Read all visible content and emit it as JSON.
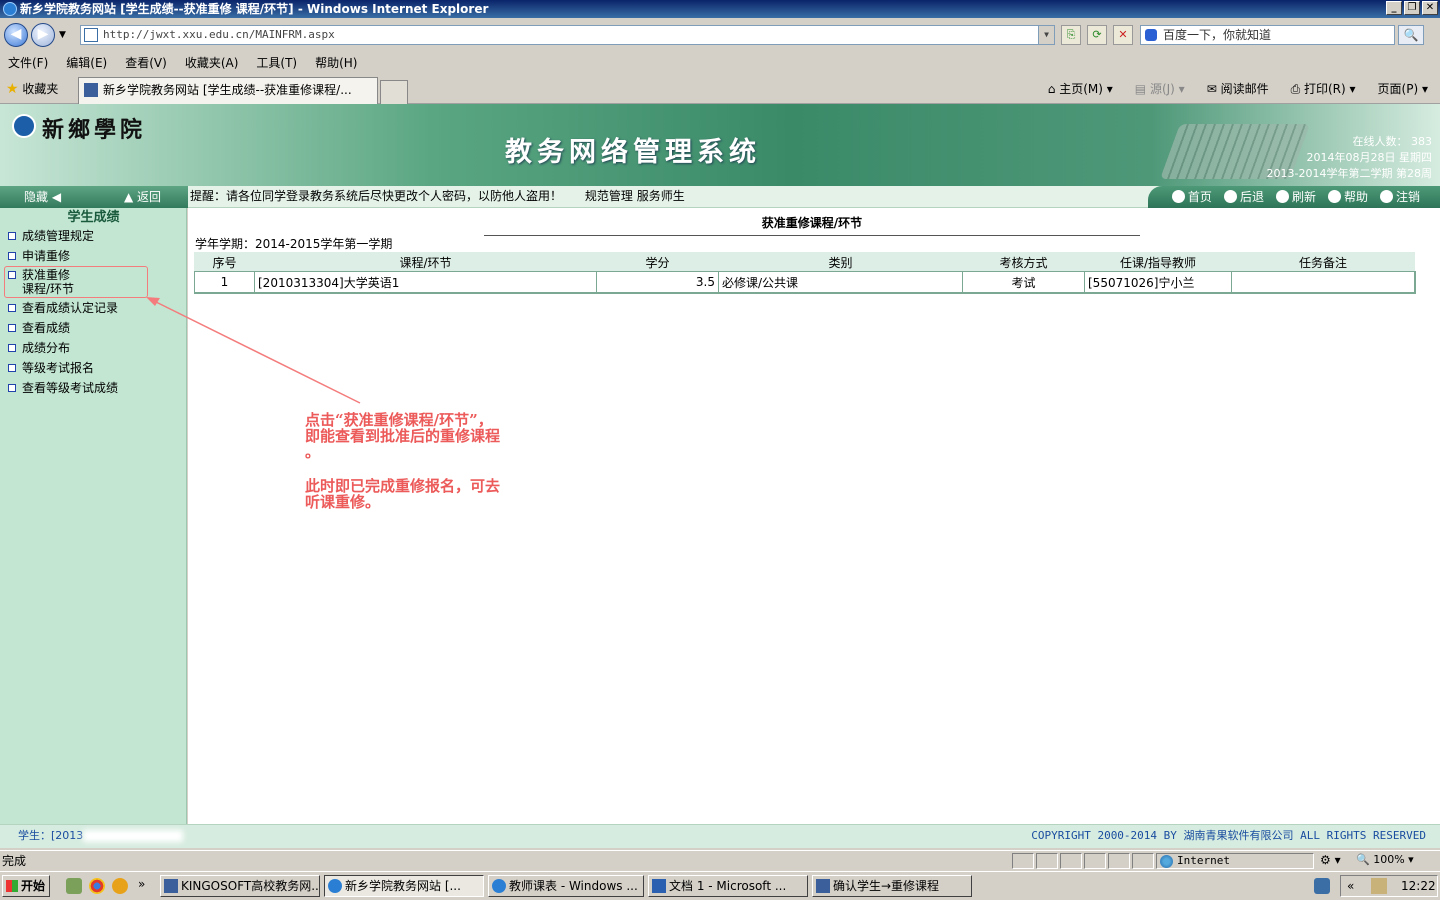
{
  "window": {
    "title": "新乡学院教务网站 [学生成绩--获准重修  课程/环节] - Windows Internet Explorer",
    "minimize": "_",
    "restore": "❐",
    "close": "✕"
  },
  "browser": {
    "address": "http://jwxt.xxu.edu.cn/MAINFRM.aspx",
    "search_text": "百度一下，你就知道",
    "menu": [
      "文件(F)",
      "编辑(E)",
      "查看(V)",
      "收藏夹(A)",
      "工具(T)",
      "帮助(H)"
    ],
    "favorites_label": "收藏夹",
    "tab_title": "新乡学院教务网站 [学生成绩--获准重修课程/...",
    "commands": {
      "home": "主页(M)",
      "feeds": "源(J)",
      "read_mail": "阅读邮件",
      "print": "打印(R)",
      "page": "页面(P)"
    }
  },
  "header": {
    "school_name": "新鄉學院",
    "system_title": "教务网络管理系统",
    "online_label": "在线人数：",
    "online_count": "383",
    "date": "2014年08月28日 星期四",
    "term_week": "2013-2014学年第二学期 第28周"
  },
  "navstrip": {
    "hide": "隐藏",
    "back": "返回",
    "notice": "提醒：请各位同学登录教务系统后尽快更改个人密码，以防他人盗用！",
    "slogan": "规范管理 服务师生",
    "links": [
      "首页",
      "后退",
      "刷新",
      "帮助",
      "注销"
    ]
  },
  "sidebar": {
    "title": "学生成绩",
    "items": [
      {
        "label": "成绩管理规定"
      },
      {
        "label": "申请重修"
      },
      {
        "label": "获准重修",
        "label2": "课程/环节"
      },
      {
        "label": "查看成绩认定记录"
      },
      {
        "label": "查看成绩"
      },
      {
        "label": "成绩分布"
      },
      {
        "label": "等级考试报名"
      },
      {
        "label": "查看等级考试成绩"
      }
    ]
  },
  "main": {
    "title": "获准重修课程/环节",
    "term_label": "学年学期：2014-2015学年第一学期",
    "columns": [
      "序号",
      "课程/环节",
      "学分",
      "类别",
      "考核方式",
      "任课/指导教师",
      "任务备注"
    ],
    "rows": [
      {
        "no": "1",
        "course": "[2010313304]大学英语1",
        "credit": "3.5",
        "category": "必修课/公共课",
        "exam": "考试",
        "teacher": "[55071026]宁小兰",
        "note": ""
      }
    ]
  },
  "annotation": {
    "line1": "点击“获准重修课程/环节”，",
    "line2": "即能查看到批准后的重修课程",
    "line3": "。",
    "line4": "此时即已完成重修报名，可去",
    "line5": "听课重修。"
  },
  "footer": {
    "student": "学生：[2013",
    "copyright": "COPYRIGHT 2000-2014 BY 湖南青果软件有限公司 ALL RIGHTS RESERVED"
  },
  "statusbar": {
    "status": "完成",
    "zone": "Internet",
    "zoom": "100%"
  },
  "taskbar": {
    "start": "开始",
    "tasks": [
      "KINGOSOFT高校教务网...",
      "新乡学院教务网站 [...",
      "教师课表 - Windows ...",
      "文档 1 - Microsoft ...",
      "确认学生→重修课程"
    ],
    "clock": "12:22"
  },
  "colors": {
    "header_green": "#3a8a68",
    "sidebar_bg": "#c2e6d2",
    "annotation_red": "#ec5a5a",
    "highlight_border": "#f47c7c"
  }
}
